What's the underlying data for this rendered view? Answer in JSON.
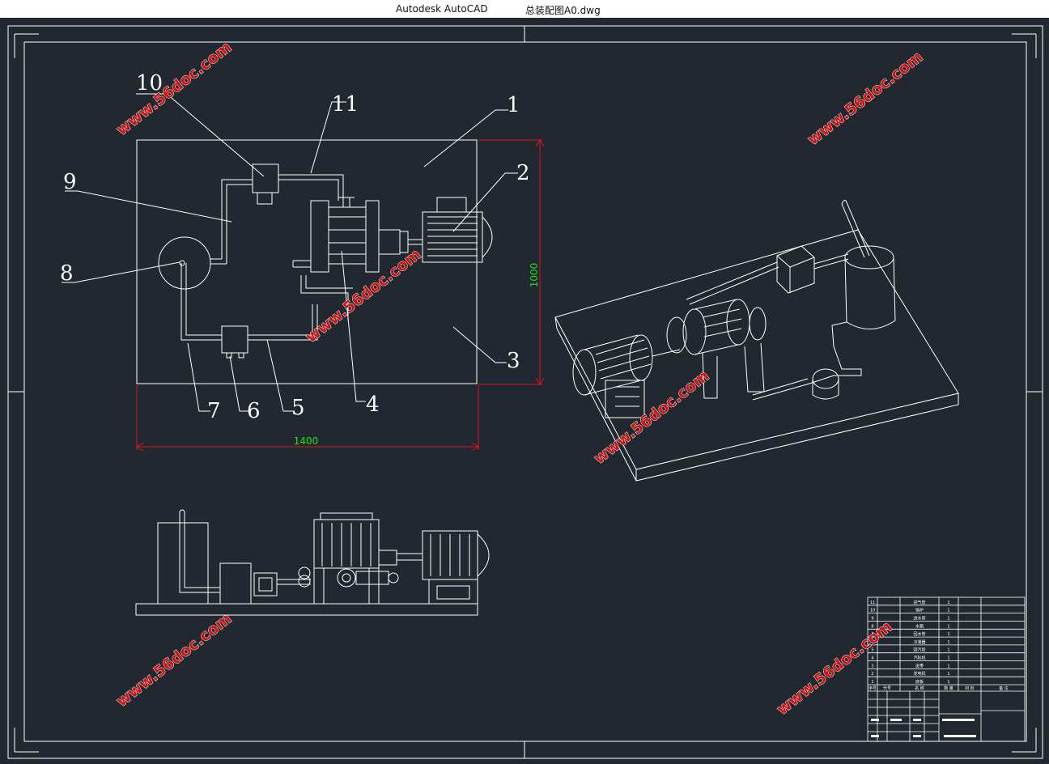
{
  "app": {
    "name": "Autodesk AutoCAD",
    "document": "总装配图A0.dwg"
  },
  "callouts": [
    "10",
    "11",
    "1",
    "2",
    "9",
    "8",
    "3",
    "7",
    "6",
    "5",
    "4"
  ],
  "dimensions": {
    "height": "1000",
    "width": "1400"
  },
  "watermark": "www.56doc.com",
  "bom": {
    "rows": [
      {
        "no": "11",
        "name": "进气管",
        "qty": "1"
      },
      {
        "no": "10",
        "name": "锅炉",
        "qty": "1"
      },
      {
        "no": "9",
        "name": "进水管",
        "qty": "1"
      },
      {
        "no": "8",
        "name": "水箱",
        "qty": "1"
      },
      {
        "no": "7",
        "name": "回水管",
        "qty": "1"
      },
      {
        "no": "6",
        "name": "冷凝器",
        "qty": "1"
      },
      {
        "no": "5",
        "name": "回汽管",
        "qty": "1"
      },
      {
        "no": "4",
        "name": "汽轮机",
        "qty": "1"
      },
      {
        "no": "3",
        "name": "皮带",
        "qty": "1"
      },
      {
        "no": "2",
        "name": "发电机",
        "qty": "1"
      },
      {
        "no": "1",
        "name": "底板",
        "qty": "1"
      }
    ],
    "header": {
      "no": "序号",
      "code": "代号",
      "name": "名 称",
      "qty": "数 量",
      "material": "材 料",
      "note": "备 注"
    }
  },
  "colors": {
    "background": "#212830",
    "lines": "#ffffff",
    "dimension": "#e0141e",
    "dimension_text": "#19e619",
    "watermark": "#c81414"
  }
}
